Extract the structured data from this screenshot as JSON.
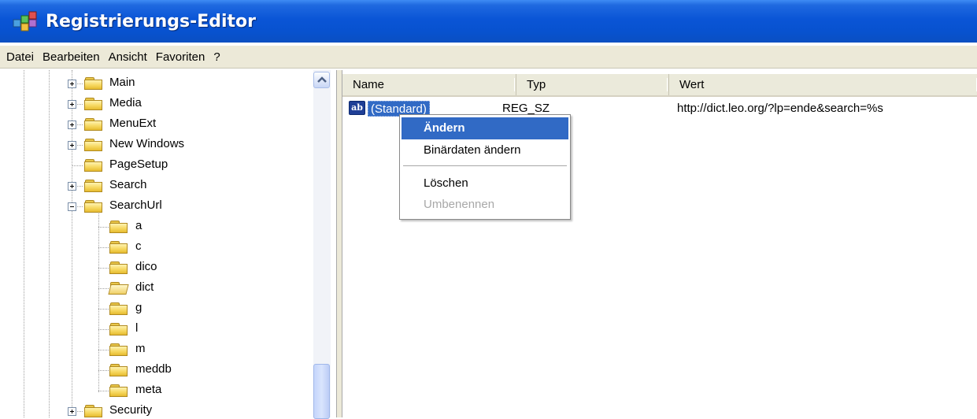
{
  "window": {
    "title": "Registrierungs-Editor"
  },
  "menubar": {
    "items": [
      "Datei",
      "Bearbeiten",
      "Ansicht",
      "Favoriten",
      "?"
    ]
  },
  "tree": {
    "items": [
      {
        "label": "Main",
        "expander": "plus"
      },
      {
        "label": "Media",
        "expander": "plus"
      },
      {
        "label": "MenuExt",
        "expander": "plus"
      },
      {
        "label": "New Windows",
        "expander": "plus"
      },
      {
        "label": "PageSetup",
        "expander": "none"
      },
      {
        "label": "Search",
        "expander": "plus"
      },
      {
        "label": "SearchUrl",
        "expander": "minus"
      },
      {
        "label": "a"
      },
      {
        "label": "c"
      },
      {
        "label": "dico"
      },
      {
        "label": "dict",
        "selected": true
      },
      {
        "label": "g"
      },
      {
        "label": "l"
      },
      {
        "label": "m"
      },
      {
        "label": "meddb"
      },
      {
        "label": "meta"
      },
      {
        "label": "Security",
        "expander": "plus"
      }
    ]
  },
  "list": {
    "columns": [
      "Name",
      "Typ",
      "Wert"
    ],
    "rows": [
      {
        "icon": "ab",
        "name": "(Standard)",
        "type": "REG_SZ",
        "value": "http://dict.leo.org/?lp=ende&search=%s"
      }
    ]
  },
  "context_menu": {
    "items": [
      "Ändern",
      "Binärdaten ändern",
      "Löschen",
      "Umbenennen"
    ]
  },
  "colors": {
    "titlebar": "#0a55d6",
    "selection": "#316ac5",
    "menubar": "#ece9d8"
  }
}
